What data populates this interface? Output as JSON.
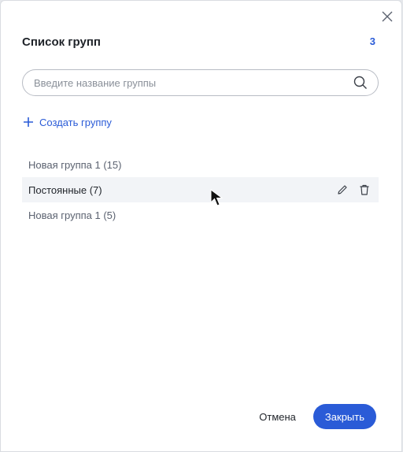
{
  "dialog": {
    "title": "Список групп",
    "count": "3",
    "close_icon": "close-icon"
  },
  "search": {
    "placeholder": "Введите название группы",
    "value": "",
    "icon": "search-icon"
  },
  "create": {
    "label": "Создать группу",
    "icon": "plus-icon"
  },
  "groups": [
    {
      "label": "Новая группа 1 (15)",
      "active": false
    },
    {
      "label": "Постоянные (7)",
      "active": true,
      "actions": [
        "pencil-icon",
        "trash-icon"
      ]
    },
    {
      "label": "Новая группа 1 (5)",
      "active": false
    }
  ],
  "footer": {
    "cancel_label": "Отмена",
    "close_label": "Закрыть"
  },
  "colors": {
    "accent": "#2a5bd7",
    "row_hover": "#f2f4f7",
    "text": "#1f2329",
    "muted_text": "#5b6270"
  }
}
